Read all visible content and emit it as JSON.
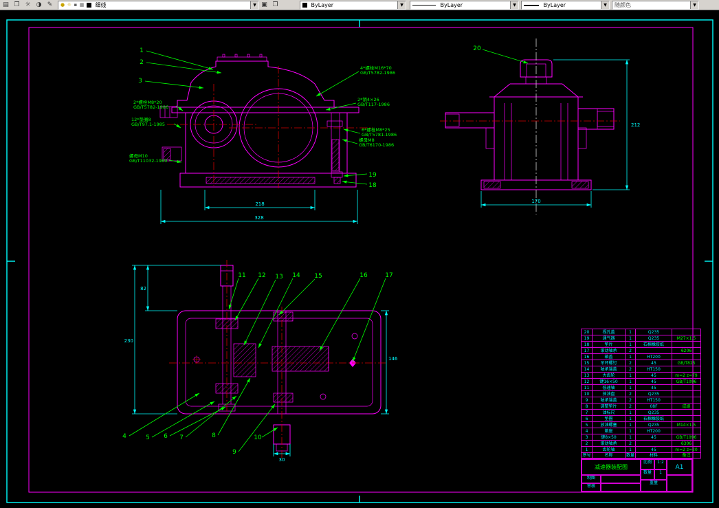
{
  "toolbar": {
    "layer": {
      "value": "细线"
    },
    "color": {
      "value": "ByLayer"
    },
    "linetype": {
      "value": "ByLayer"
    },
    "lineweight": {
      "value": "ByLayer"
    },
    "plotstyle": {
      "value": "随颜色"
    },
    "icons": {
      "app": "▤",
      "layers": "❐",
      "states": "☼",
      "isolate": "◑",
      "match": "▣",
      "prev": "✎",
      "bulb": "●",
      "sun": "☼",
      "lock": "▪",
      "printer": "▦",
      "arrow": "▼"
    }
  },
  "callouts": {
    "k1": "1",
    "k2": "2",
    "k3": "3",
    "k4": "4",
    "k5": "5",
    "k6": "6",
    "k7": "7",
    "k8": "8",
    "k9": "9",
    "k10": "10",
    "k11": "11",
    "k12": "12",
    "k13": "13",
    "k14": "14",
    "k15": "15",
    "k16": "16",
    "k17": "17",
    "k18": "18",
    "k19": "19",
    "k20": "20"
  },
  "ann": {
    "a1": [
      "4*螺栓M16*70",
      "GB/T5782-1986"
    ],
    "a2": [
      "2*销4×26",
      "GB/T117-1986"
    ],
    "a3": [
      "6*螺栓M8*25",
      "GB/T5781-1986"
    ],
    "a4": [
      "螺母M8",
      "GB/T6170-1986"
    ],
    "a5": [
      "2*螺栓M8*20",
      "GB/T5782-1986"
    ],
    "a6": [
      "12*垫圈8",
      "GB/T97.1-1985"
    ],
    "a7": [
      "螺母M10",
      "GB/T11032-1989"
    ]
  },
  "dims": {
    "d1": "218",
    "d2": "328",
    "d3": "212",
    "d4": "170",
    "d5": "82",
    "d6": "230",
    "d7": "146",
    "d8": "30"
  },
  "bom": {
    "headers": [
      "序号",
      "名称",
      "数量",
      "材料",
      "备注"
    ],
    "rows": [
      {
        "no": "20",
        "name": "视孔盖",
        "qty": "1",
        "material": "Q235",
        "note": ""
      },
      {
        "no": "19",
        "name": "通气器",
        "qty": "1",
        "material": "Q235",
        "note": "M27×1.5"
      },
      {
        "no": "18",
        "name": "垫片",
        "qty": "1",
        "material": "石棉橡胶纸",
        "note": ""
      },
      {
        "no": "17",
        "name": "滚动轴承",
        "qty": "2",
        "material": "",
        "note": "6206"
      },
      {
        "no": "16",
        "name": "箱盖",
        "qty": "1",
        "material": "HT200",
        "note": ""
      },
      {
        "no": "15",
        "name": "吊环螺钉",
        "qty": "2",
        "material": "45",
        "note": "GB/T825"
      },
      {
        "no": "14",
        "name": "轴承端盖",
        "qty": "2",
        "material": "HT150",
        "note": ""
      },
      {
        "no": "13",
        "name": "大齿轮",
        "qty": "1",
        "material": "45",
        "note": "m=2 z=79"
      },
      {
        "no": "12",
        "name": "键16×50",
        "qty": "1",
        "material": "45",
        "note": "GB/T1096"
      },
      {
        "no": "11",
        "name": "低速轴",
        "qty": "1",
        "material": "45",
        "note": ""
      },
      {
        "no": "10",
        "name": "挡油盘",
        "qty": "2",
        "material": "Q235",
        "note": ""
      },
      {
        "no": "9",
        "name": "轴承端盖",
        "qty": "2",
        "material": "HT150",
        "note": ""
      },
      {
        "no": "8",
        "name": "调整垫片",
        "qty": "2",
        "material": "08F",
        "note": "成组"
      },
      {
        "no": "7",
        "name": "油标尺",
        "qty": "1",
        "material": "Q235",
        "note": ""
      },
      {
        "no": "6",
        "name": "垫圈",
        "qty": "1",
        "material": "石棉橡胶纸",
        "note": ""
      },
      {
        "no": "5",
        "name": "放油螺塞",
        "qty": "1",
        "material": "Q235",
        "note": "M14×1.5"
      },
      {
        "no": "4",
        "name": "箱座",
        "qty": "1",
        "material": "HT200",
        "note": ""
      },
      {
        "no": "3",
        "name": "键8×50",
        "qty": "1",
        "material": "45",
        "note": "GB/T1096"
      },
      {
        "no": "2",
        "name": "滚动轴承",
        "qty": "2",
        "material": "",
        "note": "6306"
      },
      {
        "no": "1",
        "name": "齿轮轴",
        "qty": "1",
        "material": "45",
        "note": "m=2 z=20"
      }
    ]
  },
  "title_block": {
    "drawing_title": "减速器装配图",
    "sheet": "A1",
    "scale_label": "比例",
    "scale": "1:2",
    "qty_label": "数量",
    "qty": "1",
    "weight_label": "重量",
    "draw_label": "制图",
    "check_label": "审核"
  }
}
